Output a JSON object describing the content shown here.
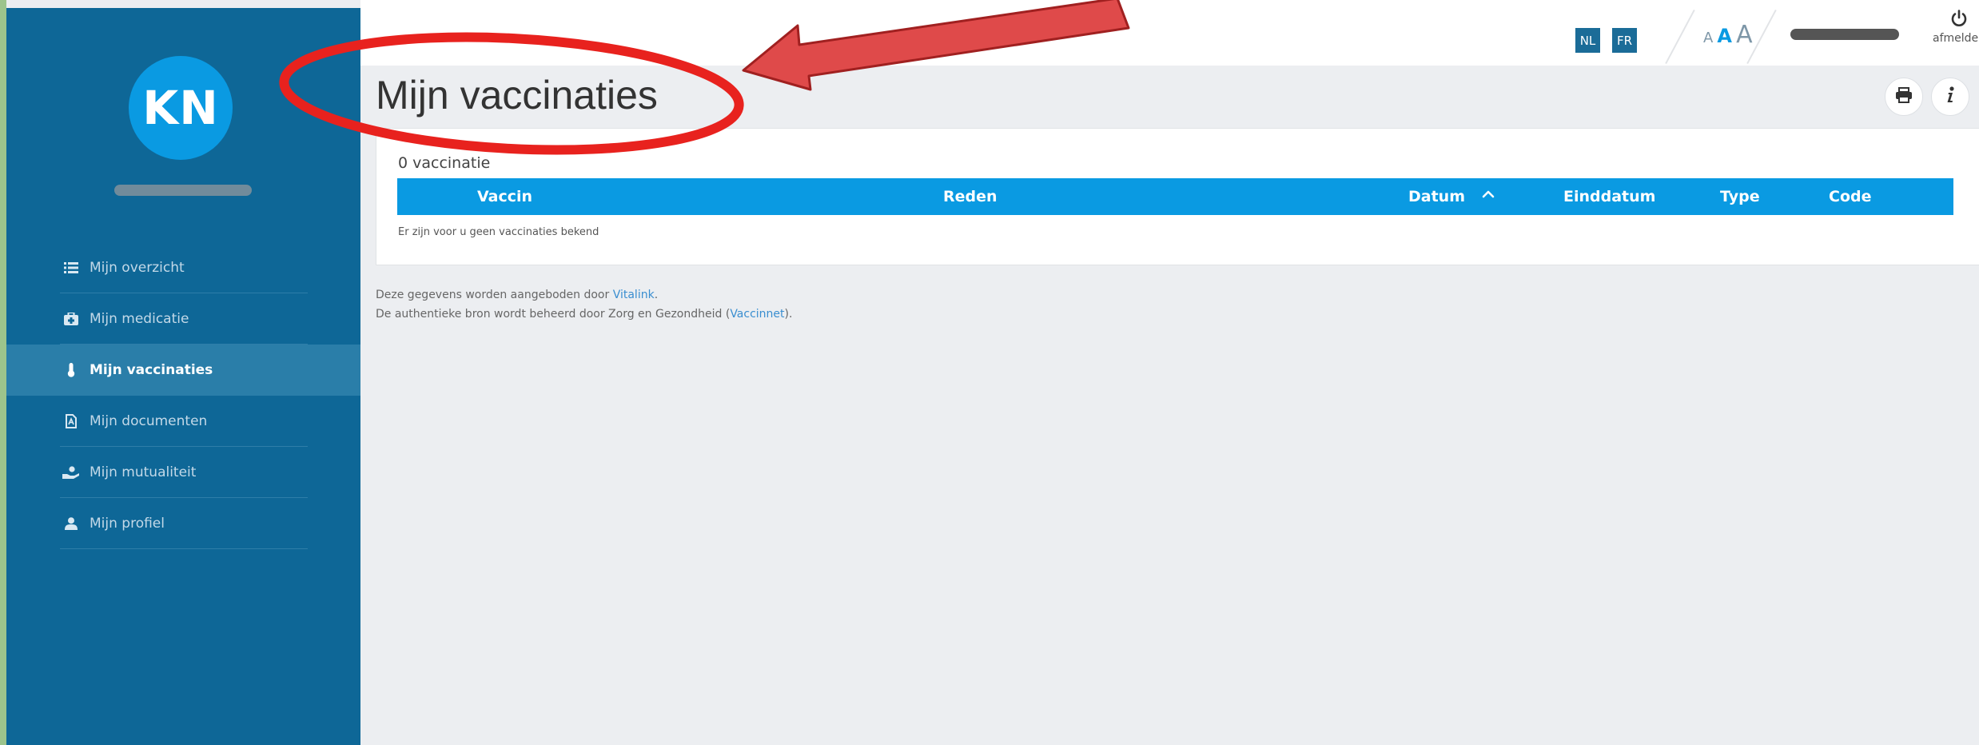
{
  "user": {
    "initials": "KN"
  },
  "nav": {
    "items": [
      {
        "label": "Mijn overzicht",
        "icon": "list-icon"
      },
      {
        "label": "Mijn medicatie",
        "icon": "medkit-icon"
      },
      {
        "label": "Mijn vaccinaties",
        "icon": "thermometer-icon",
        "active": true
      },
      {
        "label": "Mijn documenten",
        "icon": "document-icon"
      },
      {
        "label": "Mijn mutualiteit",
        "icon": "care-hand-icon"
      },
      {
        "label": "Mijn profiel",
        "icon": "user-icon"
      }
    ]
  },
  "header": {
    "lang_nl": "NL",
    "lang_fr": "FR",
    "font_sizes": [
      "A",
      "A",
      "A"
    ],
    "logout_label": "afmelden"
  },
  "page": {
    "title": "Mijn vaccinaties",
    "count_text": "0 vaccinatie",
    "table": {
      "columns": [
        "Vaccin",
        "Reden",
        "Datum",
        "Einddatum",
        "Type",
        "Code"
      ],
      "sort_indicator": "^",
      "empty_text": "Er zijn voor u geen vaccinaties bekend"
    },
    "footer": {
      "line1_prefix": "Deze gegevens worden aangeboden door ",
      "line1_link": "Vitalink",
      "line1_suffix": ".",
      "line2_prefix": "De authentieke bron wordt beheerd door Zorg en Gezondheid (",
      "line2_link": "Vaccinnet",
      "line2_suffix": ")."
    }
  },
  "colors": {
    "sidebar": "#0e6797",
    "accent": "#0a9ae2",
    "annotation": "#e8221e"
  }
}
